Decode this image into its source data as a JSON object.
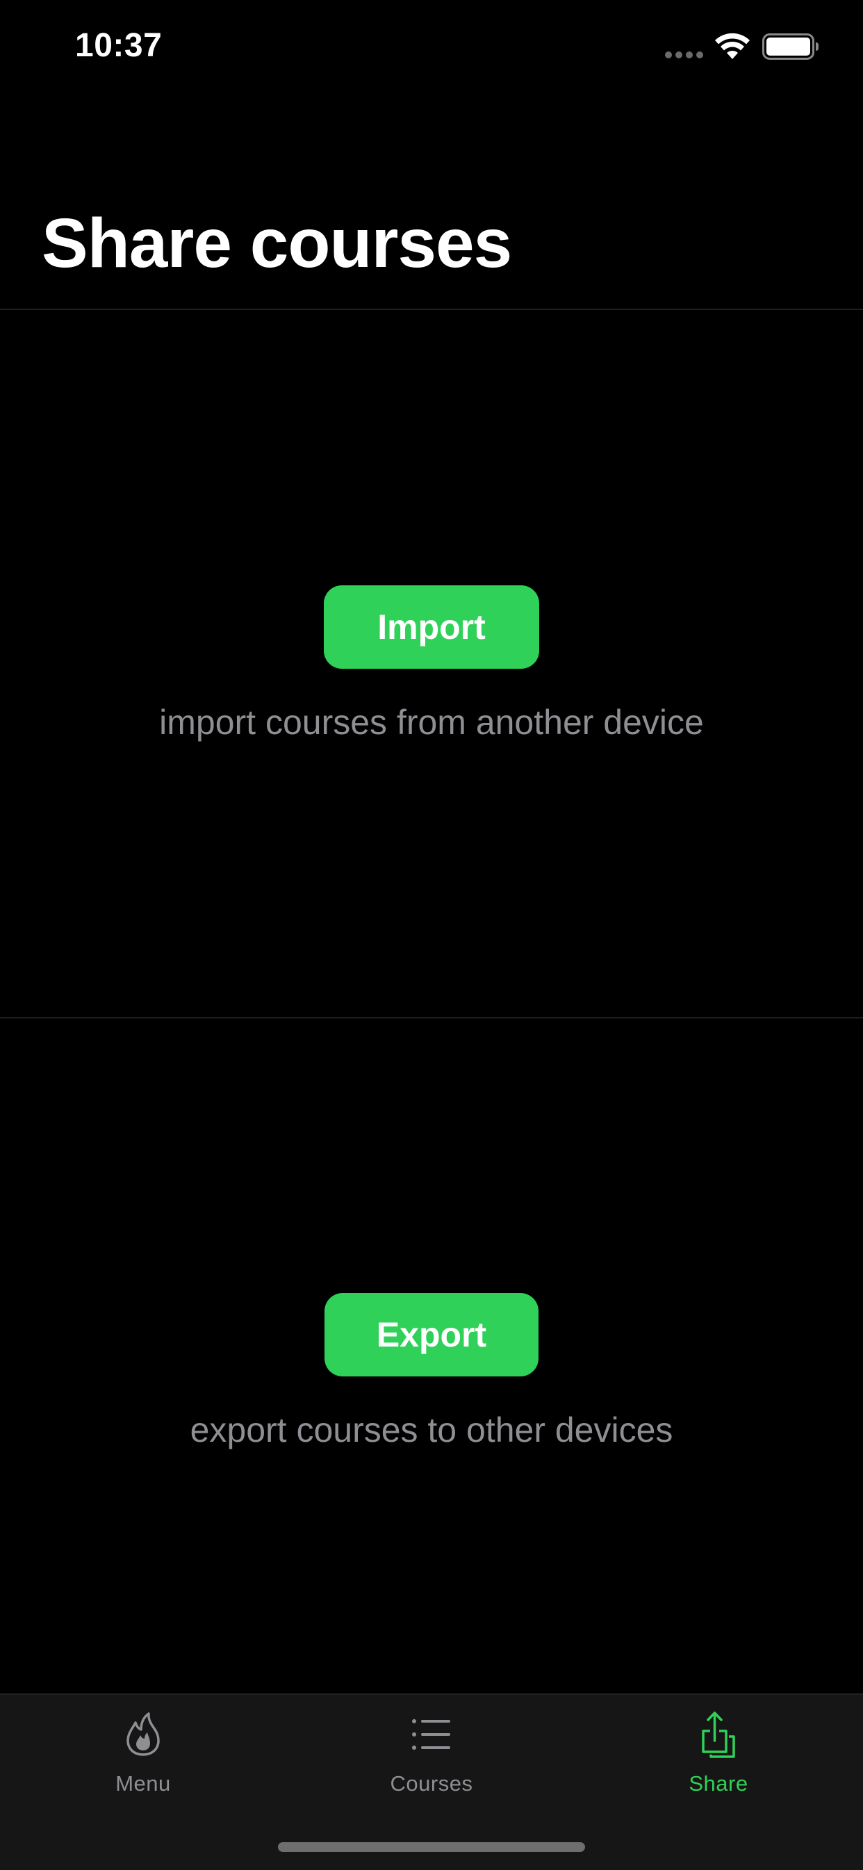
{
  "status_bar": {
    "time": "10:37"
  },
  "page": {
    "title": "Share courses"
  },
  "import_section": {
    "button_label": "Import",
    "description": "import courses from another device"
  },
  "export_section": {
    "button_label": "Export",
    "description": "export courses to other devices"
  },
  "tab_bar": {
    "tabs": [
      {
        "label": "Menu",
        "icon": "flame-icon",
        "selected": false
      },
      {
        "label": "Courses",
        "icon": "list-icon",
        "selected": false
      },
      {
        "label": "Share",
        "icon": "share-icon",
        "selected": true
      }
    ]
  },
  "colors": {
    "background": "#000000",
    "accent": "#30d158",
    "secondary_text": "#8e8e93",
    "tab_bar_background": "#161616"
  }
}
